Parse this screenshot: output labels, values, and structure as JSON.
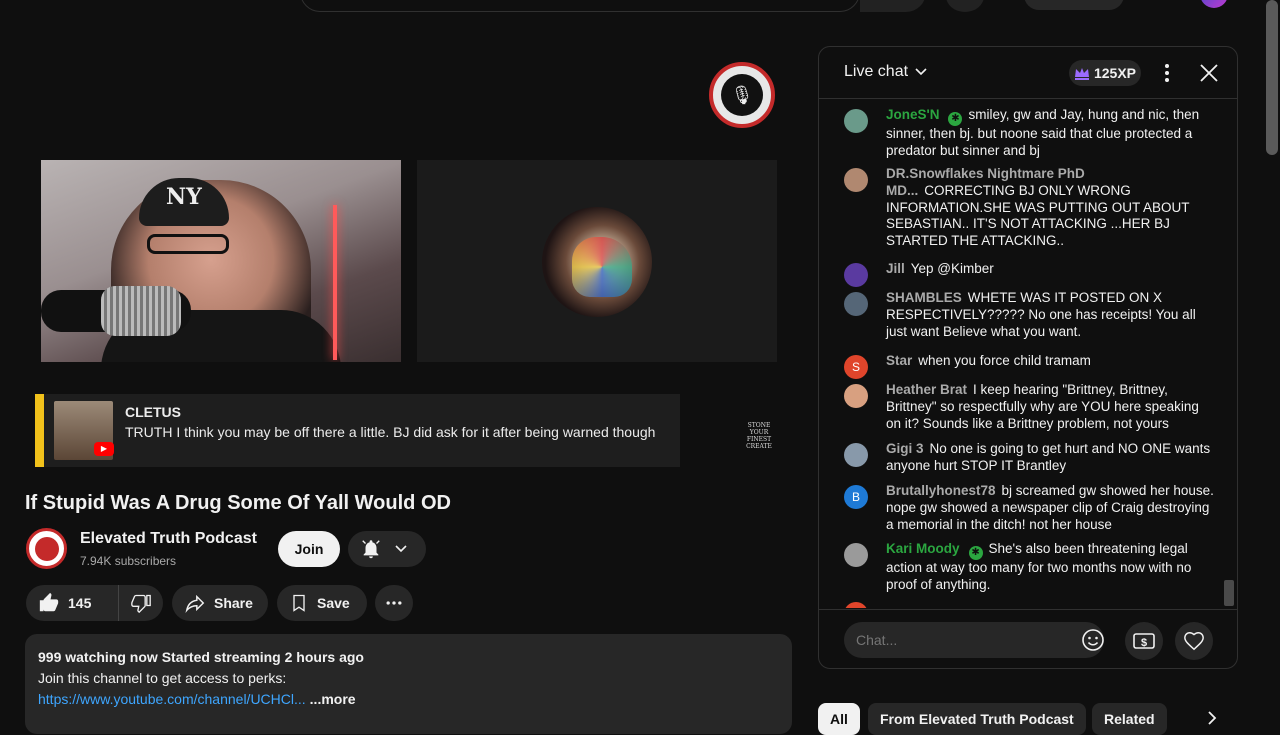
{
  "video": {
    "host_hat_logo": "NY",
    "title": "If Stupid Was A Drug Some Of Yall Would OD"
  },
  "overlay": {
    "author": "CLETUS",
    "text": "TRUTH I think you may be off there a little. BJ did ask for it after being warned though",
    "badge_text": "STONE YOUR FINEST CREATE"
  },
  "channel": {
    "name": "Elevated Truth Podcast",
    "subscribers": "7.94K subscribers",
    "join_label": "Join"
  },
  "actions": {
    "like_count": "145",
    "share_label": "Share",
    "save_label": "Save"
  },
  "description": {
    "stats": "999 watching now  Started streaming 2 hours ago",
    "line1": "Join this channel to get access to perks:",
    "link": "https://www.youtube.com/channel/UCHCl...",
    "more": "...more"
  },
  "chat": {
    "title": "Live chat",
    "xp": "125XP",
    "input_placeholder": "Chat...",
    "messages": [
      {
        "author": "JoneS'N",
        "text": "smiley, gw and Jay, hung and nic, then sinner, then bj. but noone said that clue protected a predator but sinner and bj",
        "member": true,
        "avatar_color": "#6a9a8a"
      },
      {
        "author": "DR.Snowflakes Nightmare PhD MD...",
        "text": "CORRECTING BJ ONLY WRONG INFORMATION.SHE WAS PUTTING OUT ABOUT SEBASTIAN.. IT'S NOT ATTACKING ...HER BJ STARTED THE ATTACKING..",
        "member": false,
        "avatar_color": "#b08870"
      },
      {
        "author": "Jill",
        "text": "Yep @Kimber",
        "member": false,
        "avatar_color": "#5a3aa0"
      },
      {
        "author": "SHAMBLES",
        "text": "WHETE WAS IT POSTED ON X RESPECTIVELY????? No one has receipts! You all just want Believe what you want.",
        "member": false,
        "avatar_color": "#556677"
      },
      {
        "author": "Star",
        "text": "when you force child tramam",
        "member": false,
        "avatar_color": "#e0452b",
        "initial": "S"
      },
      {
        "author": "Heather Brat",
        "text": "I keep hearing \"Brittney, Brittney, Brittney\" so respectfully why are YOU here speaking on it? Sounds like a Brittney problem, not yours",
        "member": false,
        "avatar_color": "#d8a080"
      },
      {
        "author": "Gigi 3",
        "text": "No one is going to get hurt and NO ONE wants anyone hurt STOP IT Brantley",
        "member": false,
        "avatar_color": "#8899aa"
      },
      {
        "author": "Brutallyhonest78",
        "text": "bj screamed gw showed her house. nope gw showed a newspaper clip of Craig destroying a memorial in the ditch! not her house",
        "member": false,
        "avatar_color": "#1e7ad6",
        "initial": "B"
      },
      {
        "author": "Kari Moody",
        "text": "She's also been threatening legal action at way too many for two months now with no proof of anything.",
        "member": true,
        "avatar_color": "#9a9a9a"
      }
    ]
  },
  "chips": {
    "all": "All",
    "from": "From Elevated Truth Podcast",
    "related": "Related"
  },
  "colors": {
    "background": "#0f0f0f",
    "accent_link": "#3ea6ff",
    "member_green": "#2ba640",
    "highlight_bar": "#f2c21b"
  }
}
